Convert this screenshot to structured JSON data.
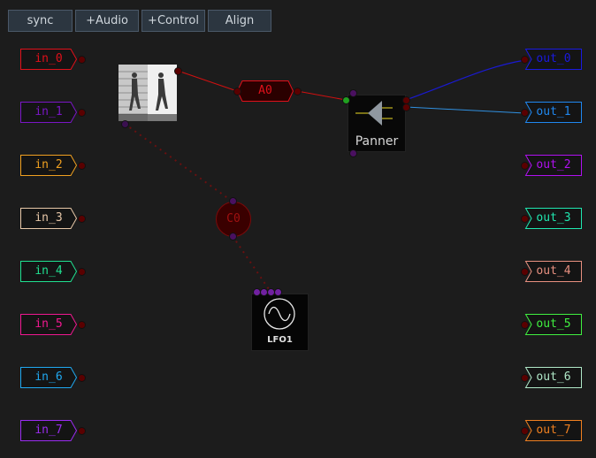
{
  "toolbar": {
    "sync_label": "sync",
    "audio_label": "+Audio",
    "control_label": "+Control",
    "align_label": "Align"
  },
  "inputs": [
    {
      "label": "in_0",
      "color": "#e0101a"
    },
    {
      "label": "in_1",
      "color": "#7a16c6"
    },
    {
      "label": "in_2",
      "color": "#f0a020"
    },
    {
      "label": "in_3",
      "color": "#e8c8a8"
    },
    {
      "label": "in_4",
      "color": "#20e090"
    },
    {
      "label": "in_5",
      "color": "#f01890"
    },
    {
      "label": "in_6",
      "color": "#20a8f0"
    },
    {
      "label": "in_7",
      "color": "#9a2cf0"
    }
  ],
  "outputs": [
    {
      "label": "out_0",
      "color": "#1a1ae0"
    },
    {
      "label": "out_1",
      "color": "#2088f0"
    },
    {
      "label": "out_2",
      "color": "#b010f0"
    },
    {
      "label": "out_3",
      "color": "#20e8b0"
    },
    {
      "label": "out_4",
      "color": "#e89080"
    },
    {
      "label": "out_5",
      "color": "#40f040"
    },
    {
      "label": "out_6",
      "color": "#b0e8c8"
    },
    {
      "label": "out_7",
      "color": "#f08020"
    }
  ],
  "nodes": {
    "audio_bus": {
      "label": "A0",
      "color": "#e0101a"
    },
    "panner": {
      "label": "Panner"
    },
    "control_bus": {
      "label": "C0"
    },
    "lfo": {
      "label": "LFO1"
    }
  },
  "colors": {
    "background": "#1c1c1c",
    "audio_wire": "#d01010",
    "out0_wire": "#1a1ad0",
    "out1_wire": "#3090e0",
    "control_wire": "#6a1010"
  }
}
